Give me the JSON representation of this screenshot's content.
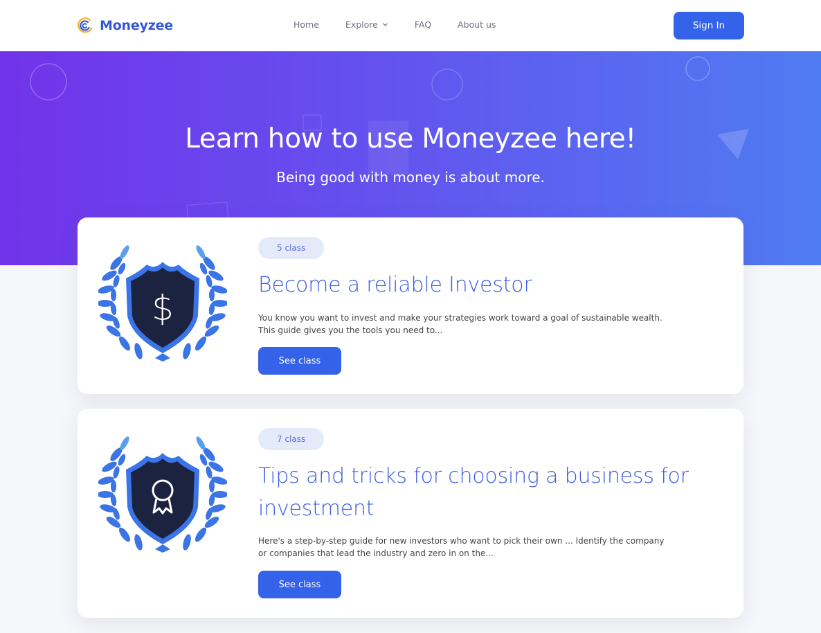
{
  "header": {
    "brand": "Moneyzee",
    "nav": [
      {
        "label": "Home"
      },
      {
        "label": "Explore",
        "has_dropdown": true
      },
      {
        "label": "FAQ"
      },
      {
        "label": "About us"
      }
    ],
    "signin_label": "Sign In"
  },
  "hero": {
    "title": "Learn how to use Moneyzee here!",
    "subtitle": "Being good with money is about more."
  },
  "cards": [
    {
      "badge": "5 class",
      "title": "Become a reliable Investor",
      "description": "You know you want to invest and make your strategies work toward a goal of sustainable wealth. This guide gives you the tools you need to...",
      "button_label": "See class",
      "icon": "dollar-shield-icon"
    },
    {
      "badge": "7 class",
      "title": "Tips and tricks for choosing a business for investment",
      "description": "Here's a step-by-step guide for new investors who want to pick their own ... Identify the company or companies that lead the industry and zero in on the...",
      "button_label": "See class",
      "icon": "award-shield-icon"
    }
  ],
  "colors": {
    "primary": "#3462e8",
    "hero_start": "#7233ea",
    "hero_end": "#4f7cf2",
    "shield": "#1c2340",
    "laurel": "#3b74e6"
  }
}
